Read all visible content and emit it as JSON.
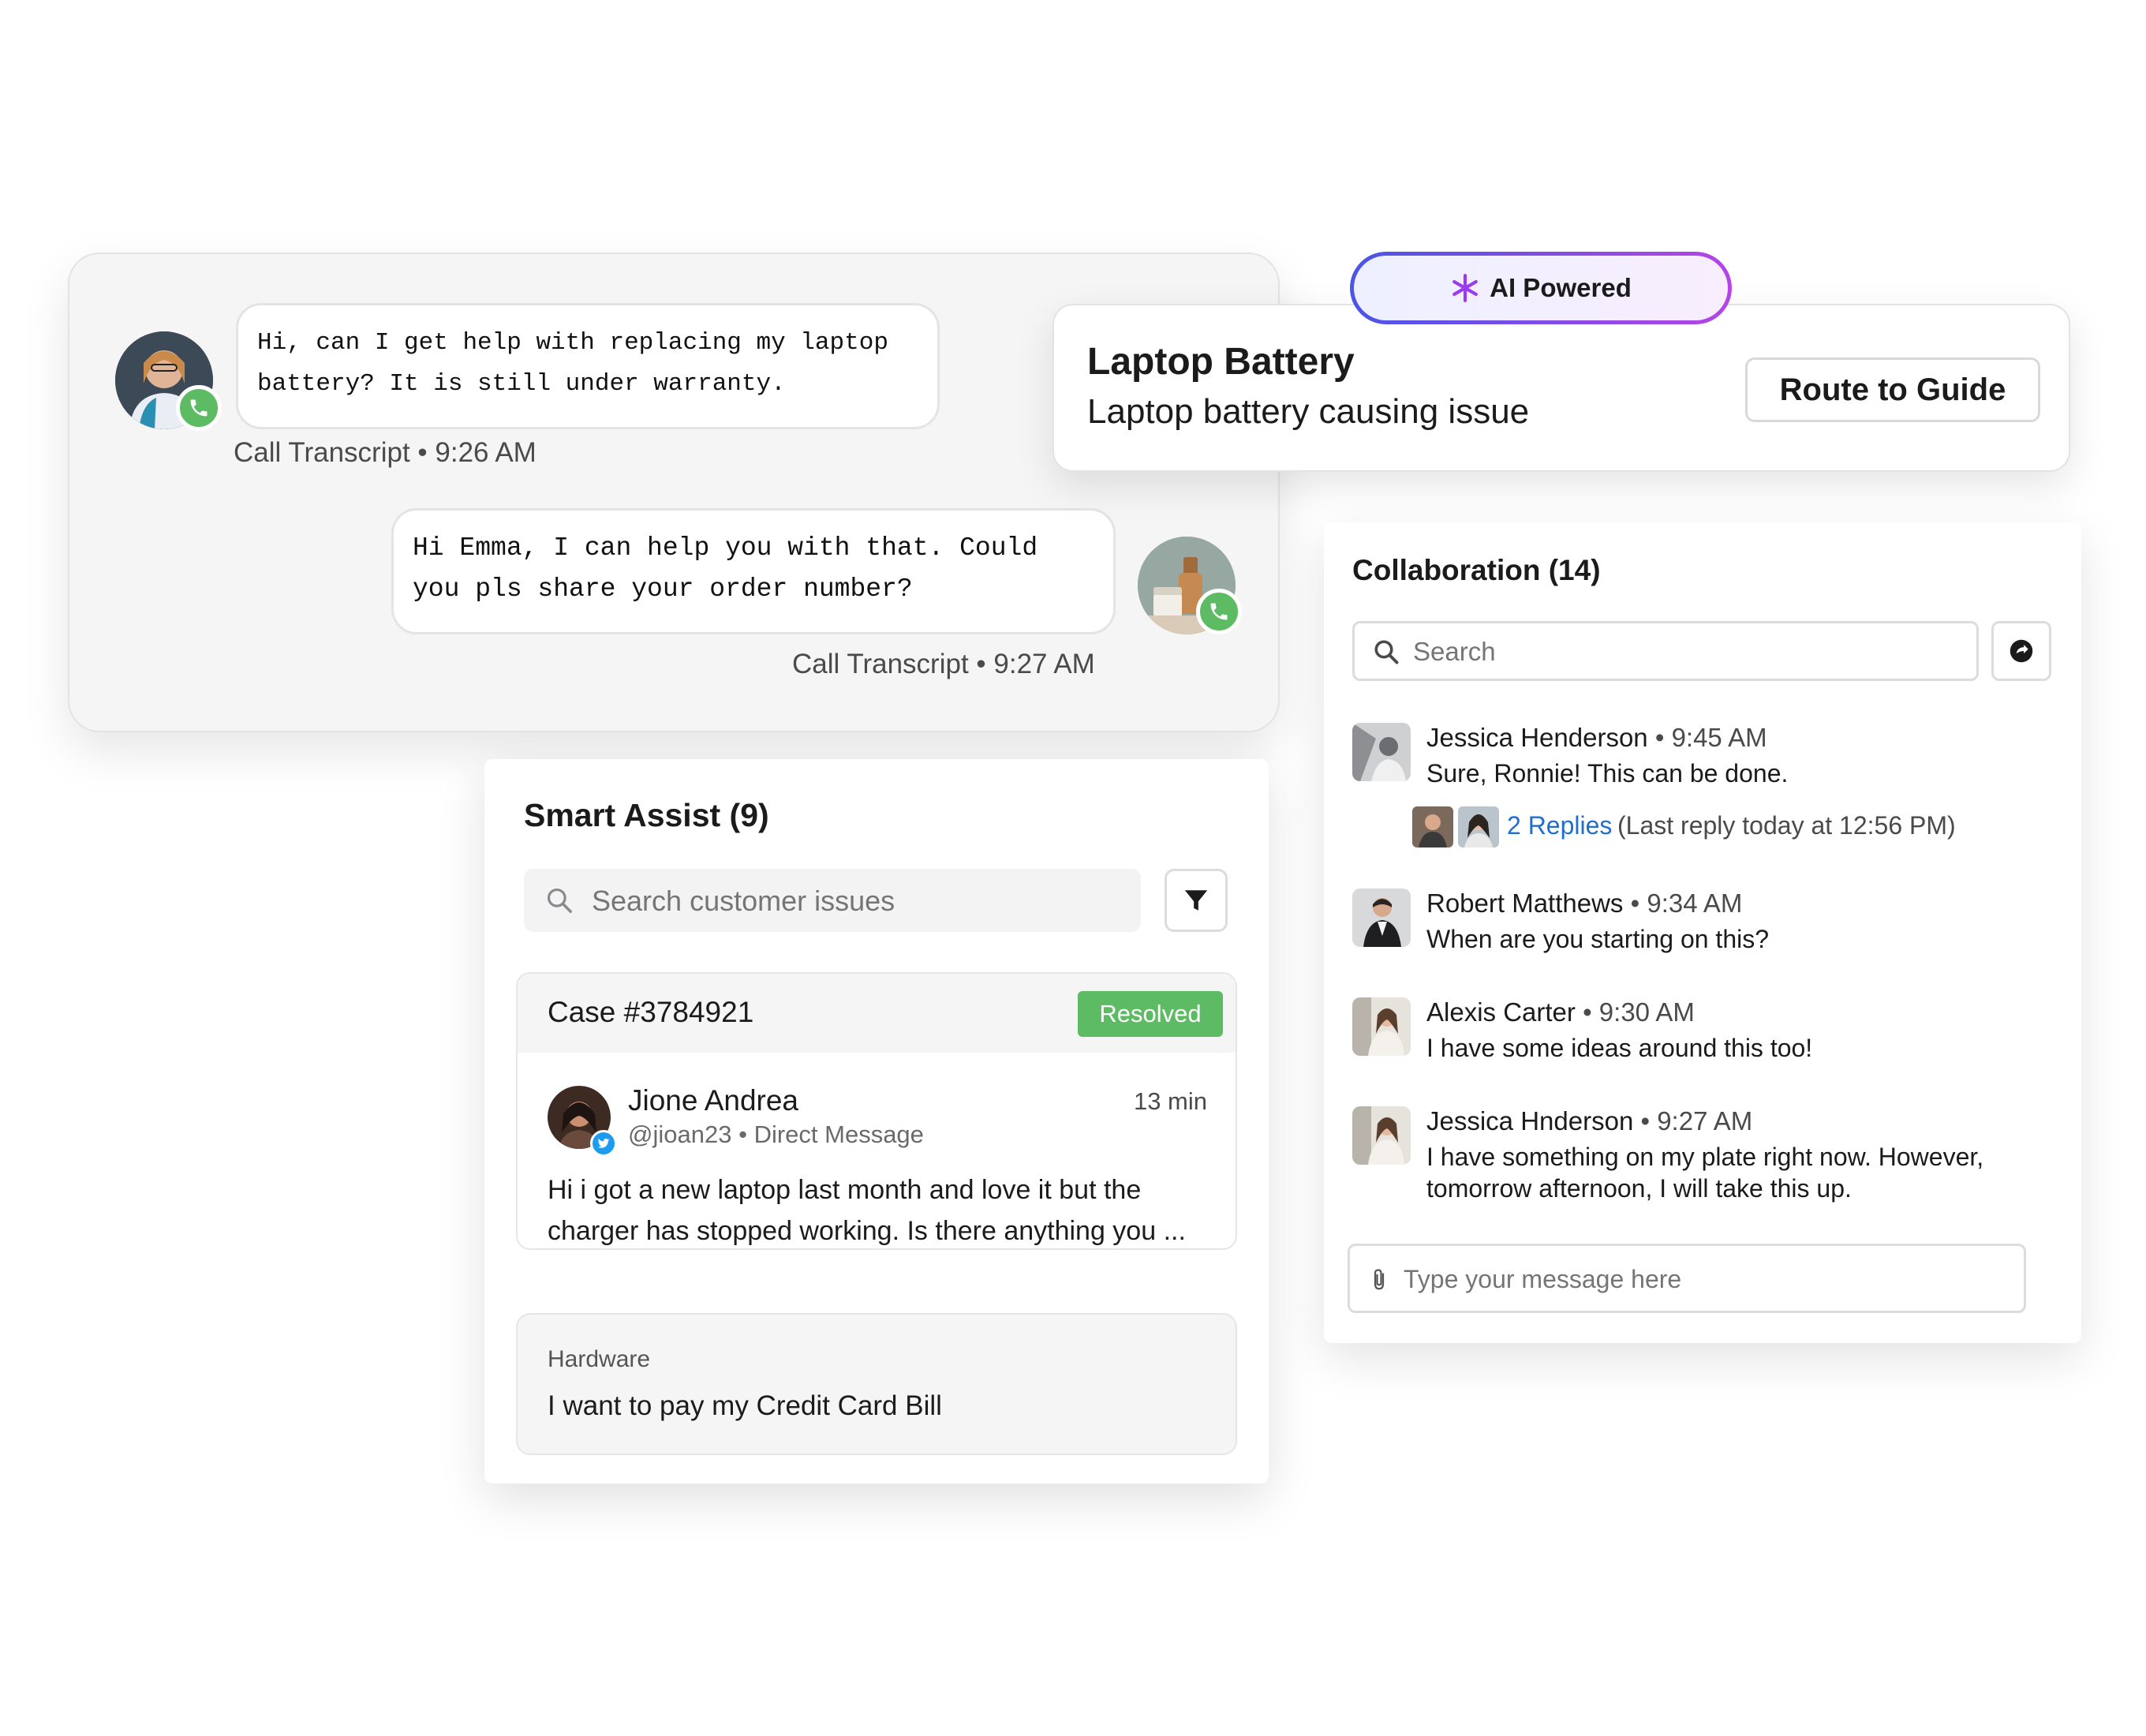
{
  "call_transcript": {
    "customer_message": "Hi, can I get help with replacing my laptop battery? It is still under warranty.",
    "customer_meta_label": "Call Transcript",
    "customer_meta_time": "9:26 AM",
    "agent_message": "Hi Emma, I can help you with that. Could you pls share your order number?",
    "agent_meta_label": "Call Transcript",
    "agent_meta_time": "9:27 AM",
    "meta_separator": "•"
  },
  "ai_panel": {
    "badge_label": "AI Powered",
    "title": "Laptop Battery",
    "subtitle": "Laptop battery causing issue",
    "route_button_label": "Route to Guide"
  },
  "collaboration": {
    "title": "Collaboration (14)",
    "search_placeholder": "Search",
    "messages": [
      {
        "name": "Jessica Henderson",
        "time": "9:45 AM",
        "text": "Sure, Ronnie! This can be done."
      },
      {
        "name": "Robert Matthews",
        "time": "9:34 AM",
        "text": "When are you starting on this?"
      },
      {
        "name": "Alexis Carter",
        "time": "9:30 AM",
        "text": "I have some ideas around this too!"
      },
      {
        "name": "Jessica Hnderson",
        "time": "9:27 AM",
        "text_line1": "I have something on my plate right now. However,",
        "text_line2": "tomorrow afternoon, I will take this up."
      }
    ],
    "replies_link": "2 Replies",
    "replies_meta": "(Last reply today at 12:56 PM)",
    "message_placeholder": "Type your message here"
  },
  "smart_assist": {
    "title": "Smart Assist (9)",
    "search_placeholder": "Search customer issues",
    "case": {
      "number": "Case #3784921",
      "status": "Resolved",
      "author_name": "Jione Andrea",
      "handle": "@jioan23",
      "channel": "Direct Message",
      "age": "13 min",
      "text_line1": "Hi i got a new laptop last month and love it but the",
      "text_line2": "charger has stopped working.  Is there anything you ..."
    },
    "suggestion": {
      "category": "Hardware",
      "text": "I want to pay my Credit Card Bill"
    }
  },
  "colors": {
    "accent_link": "#1f6fd1",
    "status_green": "#5dbb63",
    "ai_gradient_start": "#4a55e6",
    "ai_gradient_end": "#b644e6"
  },
  "icons": [
    "phone-icon",
    "sparkle-icon",
    "search-icon",
    "refresh-icon",
    "filter-icon",
    "paperclip-icon",
    "twitter-icon"
  ]
}
